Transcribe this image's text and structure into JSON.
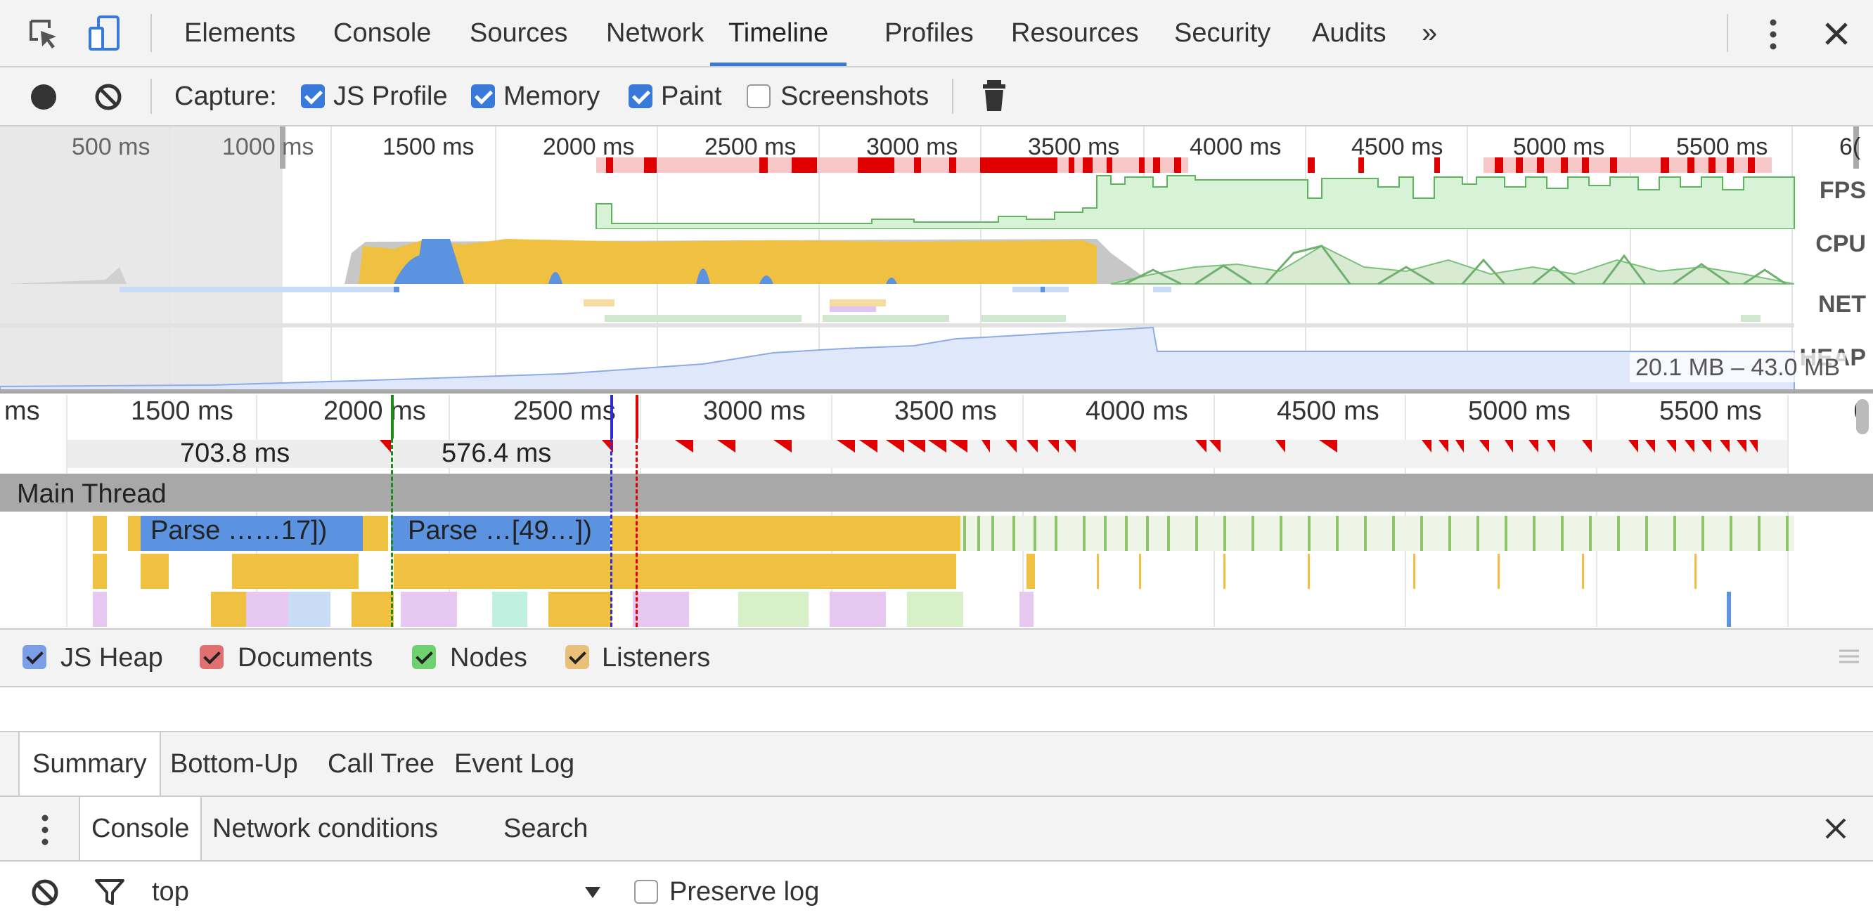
{
  "tabs": [
    "Elements",
    "Console",
    "Sources",
    "Network",
    "Timeline",
    "Profiles",
    "Resources",
    "Security",
    "Audits"
  ],
  "selected_tab": "Timeline",
  "more_tabs": "»",
  "toolbar": {
    "capture_label": "Capture:",
    "checkboxes": [
      {
        "label": "JS Profile",
        "checked": true
      },
      {
        "label": "Memory",
        "checked": true
      },
      {
        "label": "Paint",
        "checked": true
      },
      {
        "label": "Screenshots",
        "checked": false
      }
    ]
  },
  "overview": {
    "ticks": [
      "500 ms",
      "1000 ms",
      "1500 ms",
      "2000 ms",
      "2500 ms",
      "3000 ms",
      "3500 ms",
      "4000 ms",
      "4500 ms",
      "5000 ms",
      "5500 ms",
      "6("
    ],
    "tracks": [
      "FPS",
      "CPU",
      "NET",
      "HEAP"
    ],
    "heap_range": "20.1 MB – 43.0 MB"
  },
  "flame": {
    "ticks": [
      "ms",
      "1500 ms",
      "2000 ms",
      "2500 ms",
      "3000 ms",
      "3500 ms",
      "4000 ms",
      "4500 ms",
      "5000 ms",
      "5500 ms",
      "6"
    ],
    "frame_durations": [
      "703.8 ms",
      "576.4 ms"
    ],
    "main_thread_label": "Main Thread",
    "events": [
      "Parse ……17])",
      "Parse …[49…])"
    ]
  },
  "counters": [
    {
      "label": "JS Heap",
      "color": "#7b9ee6"
    },
    {
      "label": "Documents",
      "color": "#e07070"
    },
    {
      "label": "Nodes",
      "color": "#6fd06f"
    },
    {
      "label": "Listeners",
      "color": "#e8c07a"
    }
  ],
  "detail_tabs": [
    "Summary",
    "Bottom-Up",
    "Call Tree",
    "Event Log"
  ],
  "drawer_tabs": [
    "Console",
    "Network conditions",
    "Search"
  ],
  "console": {
    "context": "top",
    "preserve_log_label": "Preserve log"
  }
}
